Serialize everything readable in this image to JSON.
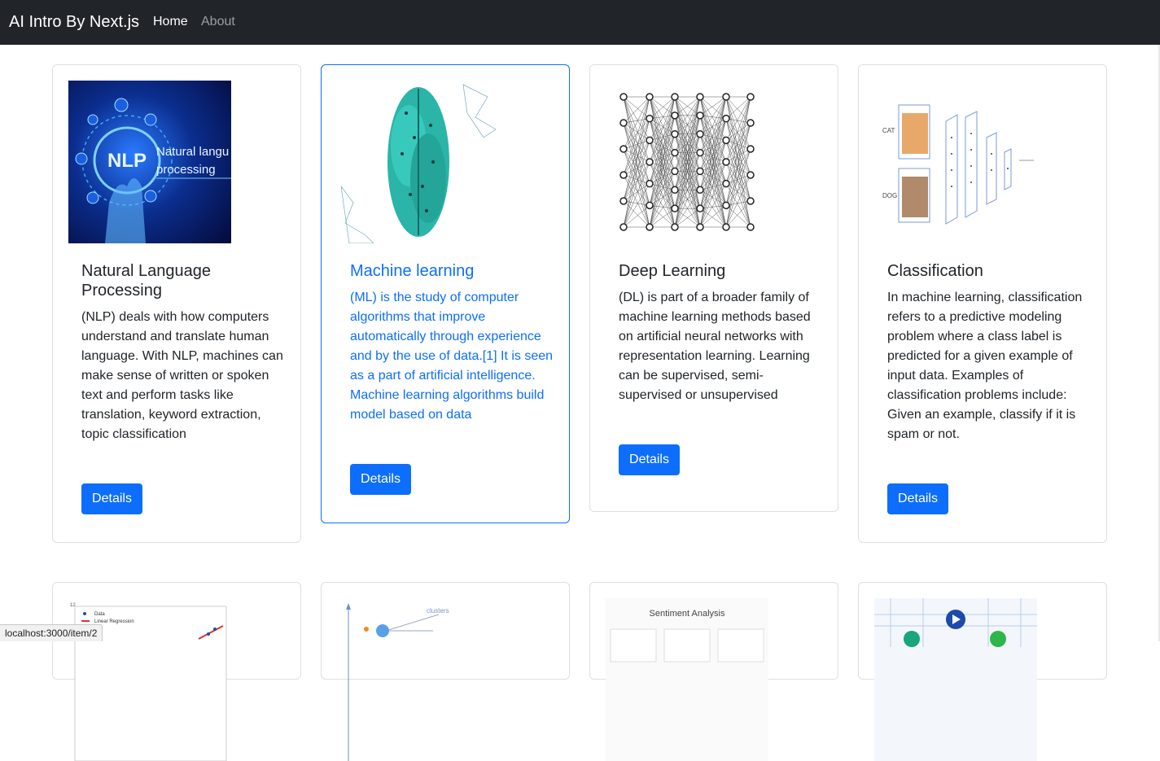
{
  "navbar": {
    "brand": "AI Intro By Next.js",
    "links": [
      "Home",
      "About"
    ]
  },
  "cards": [
    {
      "title": "Natural Language Processing",
      "text": "(NLP) deals with how computers understand and translate human language. With NLP, machines can make sense of written or spoken text and perform tasks like translation, keyword extraction, topic classification",
      "button": "Details",
      "image_text_1": "NLP",
      "image_text_2": "Natural langu",
      "image_text_3": "processing"
    },
    {
      "title": "Machine learning",
      "text": "(ML) is the study of computer algorithms that improve automatically through experience and by the use of data.[1] It is seen as a part of artificial intelligence. Machine learning algorithms build model based on data",
      "button": "Details"
    },
    {
      "title": "Deep Learning",
      "text": "(DL) is part of a broader family of machine learning methods based on artificial neural networks with representation learning. Learning can be supervised, semi-supervised or unsupervised",
      "button": "Details"
    },
    {
      "title": "Classification",
      "text": "In machine learning, classification refers to a predictive modeling problem where a class label is predicted for a given example of input data. Examples of classification problems include: Given an example, classify if it is spam or not.",
      "button": "Details",
      "image_labels": [
        "CAT",
        "DOG"
      ]
    }
  ],
  "lower_cards": [
    {
      "legend": [
        "Data",
        "Linear Regression"
      ]
    },
    {
      "label": "clusters"
    },
    {
      "label": "Sentiment Analysis"
    },
    {}
  ],
  "status_url": "localhost:3000/item/2",
  "colors": {
    "navbar": "#212529",
    "primary": "#0d6efd"
  }
}
